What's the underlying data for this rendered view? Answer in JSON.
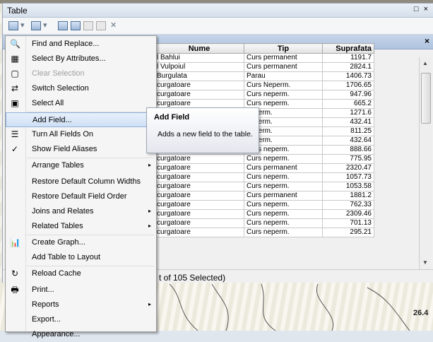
{
  "window": {
    "title": "Table",
    "controls": "□ ×"
  },
  "toolbar": {
    "buttons": [
      "table-options",
      "select-by-attributes",
      "switch-selection",
      "clear-selection",
      "zoom-to-selected",
      "delete-selected"
    ],
    "delete_glyph": "✕"
  },
  "tab": {
    "close": "×"
  },
  "table": {
    "columns": [
      "Nume",
      "Tip",
      "Suprafata"
    ],
    "rows": [
      [
        "l Bahlui",
        "Curs permanent",
        "1191.7"
      ],
      [
        "l Vulpoiul",
        "Curs permanent",
        "2824.1"
      ],
      [
        "Burgulata",
        "Parau",
        "1406.73"
      ],
      [
        "curgatoare",
        "Curs Neperm.",
        "1706.65"
      ],
      [
        "curgatoare",
        "Curs neperm.",
        "947.96"
      ],
      [
        "curgatoare",
        "Curs neperm.",
        "665.2"
      ],
      [
        "curgatoare",
        "neperm.",
        "1271.6"
      ],
      [
        "curgatoare",
        "neperm.",
        "432.41"
      ],
      [
        "curgatoare",
        "neperm.",
        "811.25"
      ],
      [
        "curgatoare",
        "neperm.",
        "432.64"
      ],
      [
        "curgatoare",
        "Curs neperm.",
        "888.66"
      ],
      [
        "curgatoare",
        "Curs neperm.",
        "775.95"
      ],
      [
        "curgatoare",
        "Curs permanent",
        "2320.47"
      ],
      [
        "curgatoare",
        "Curs neperm.",
        "1057.73"
      ],
      [
        "curgatoare",
        "Curs neperm.",
        "1053.58"
      ],
      [
        "curgatoare",
        "Curs permanent",
        "1881.2"
      ],
      [
        "curgatoare",
        "Curs neperm.",
        "762.33"
      ],
      [
        "curgatoare",
        "Curs neperm.",
        "2309.46"
      ],
      [
        "curgatoare",
        "Curs neperm.",
        "701.13"
      ],
      [
        "curgatoare",
        "Curs neperm.",
        "295.21"
      ]
    ]
  },
  "status": {
    "text": "t of 105 Selected)"
  },
  "menu": {
    "items": [
      {
        "label": "Find and Replace...",
        "icon": "binoculars-icon",
        "glyph": "🔍"
      },
      {
        "label": "Select By Attributes...",
        "icon": "select-attributes-icon",
        "glyph": "▦"
      },
      {
        "label": "Clear Selection",
        "icon": "clear-selection-icon",
        "glyph": "▢",
        "disabled": true
      },
      {
        "label": "Switch Selection",
        "icon": "switch-selection-icon",
        "glyph": "⇄"
      },
      {
        "label": "Select All",
        "icon": "select-all-icon",
        "glyph": "▣"
      },
      {
        "label": "Add Field...",
        "icon": "",
        "glyph": "",
        "highlight": true
      },
      {
        "label": "Turn All Fields On",
        "icon": "fields-on-icon",
        "glyph": "☰"
      },
      {
        "label": "Show Field Aliases",
        "icon": "check-icon",
        "glyph": "✓"
      },
      {
        "label": "Arrange Tables",
        "submenu": true
      },
      {
        "label": "Restore Default Column Widths"
      },
      {
        "label": "Restore Default Field Order"
      },
      {
        "label": "Joins and Relates",
        "submenu": true
      },
      {
        "label": "Related Tables",
        "submenu": true
      },
      {
        "label": "Create Graph...",
        "icon": "graph-icon",
        "glyph": "📊"
      },
      {
        "label": "Add Table to Layout"
      },
      {
        "label": "Reload Cache",
        "icon": "reload-icon",
        "glyph": "↻"
      },
      {
        "label": "Print...",
        "icon": "print-icon",
        "glyph": "🖶"
      },
      {
        "label": "Reports",
        "submenu": true
      },
      {
        "label": "Export..."
      },
      {
        "label": "Appearance..."
      }
    ],
    "submenu_arrow": "▸"
  },
  "tooltip": {
    "title": "Add Field",
    "body": "Adds a new field to the table."
  },
  "map": {
    "label": "26.4"
  },
  "colors": {
    "highlight": "#cfe0f5",
    "tab_header": "#afc3df"
  }
}
